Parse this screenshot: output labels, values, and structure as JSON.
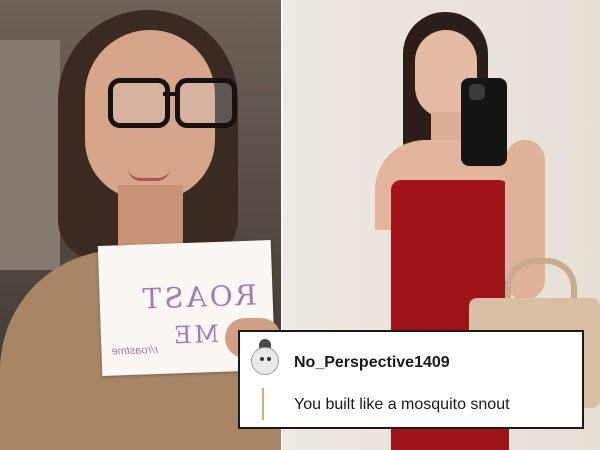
{
  "sign": {
    "line1": "ROAST",
    "line2": "ME",
    "subtitle": "r/roastme"
  },
  "comment": {
    "username": "No_Perspective1409",
    "text": "You built like a mosquito snout",
    "avatar_icon": "snoo-avatar-icon",
    "thread_color": "#c8b478"
  },
  "colors": {
    "dress": "#9e1419",
    "card_border": "#1a1a1a"
  }
}
